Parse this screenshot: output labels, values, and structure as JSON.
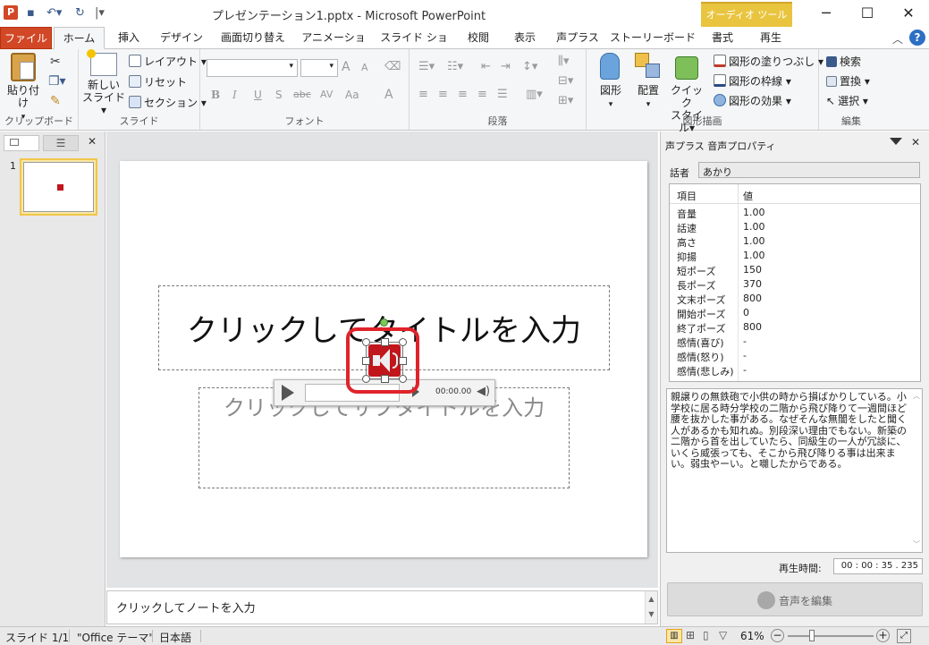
{
  "window": {
    "title": "プレゼンテーション1.pptx - Microsoft PowerPoint",
    "context_group": "オーディオ ツール",
    "minimize": "─",
    "maximize": "☐",
    "close": "✕"
  },
  "tabs": [
    "ファイル",
    "ホーム",
    "挿入",
    "デザイン",
    "画面切り替え",
    "アニメーション",
    "スライド ショー",
    "校閲",
    "表示",
    "声プラス",
    "ストーリーボード",
    "書式",
    "再生"
  ],
  "ribbon": {
    "clipboard": {
      "paste": "貼り付け",
      "label": "クリップボード"
    },
    "slides": {
      "new_slide_1": "新しい",
      "new_slide_2": "スライド",
      "layout": "レイアウト",
      "reset": "リセット",
      "section": "セクション",
      "label": "スライド"
    },
    "font": {
      "label": "フォント",
      "bold": "B",
      "italic": "I",
      "underline": "U",
      "shadow": "S",
      "strike": "abc",
      "spacing": "AV",
      "case": "Aa",
      "grow": "A",
      "shrink": "A",
      "color": "A"
    },
    "paragraph": {
      "label": "段落"
    },
    "drawing": {
      "shapes": "図形",
      "arrange": "配置",
      "quick_style_1": "クイック",
      "quick_style_2": "スタイル",
      "fill": "図形の塗りつぶし",
      "outline": "図形の枠線",
      "effects": "図形の効果",
      "label": "図形描画"
    },
    "editing": {
      "find": "検索",
      "replace": "置換",
      "select": "選択",
      "label": "編集"
    }
  },
  "thumbnails": {
    "number": "1"
  },
  "slide": {
    "title_placeholder": "クリックしてタイトルを入力",
    "subtitle_placeholder": "クリックしてサブタイトルを入力"
  },
  "audio_player": {
    "time": "00:00.00"
  },
  "notes": {
    "placeholder": "クリックしてノートを入力"
  },
  "pane": {
    "title": "声プラス 音声プロパティ",
    "speaker_label": "話者",
    "speaker_value": "あかり",
    "table_headers": [
      "項目",
      "値"
    ],
    "properties": [
      {
        "name": "音量",
        "value": "1.00"
      },
      {
        "name": "話速",
        "value": "1.00"
      },
      {
        "name": "高さ",
        "value": "1.00"
      },
      {
        "name": "抑揚",
        "value": "1.00"
      },
      {
        "name": "短ポーズ",
        "value": "150"
      },
      {
        "name": "長ポーズ",
        "value": "370"
      },
      {
        "name": "文末ポーズ",
        "value": "800"
      },
      {
        "name": "開始ポーズ",
        "value": "0"
      },
      {
        "name": "終了ポーズ",
        "value": "800"
      },
      {
        "name": "感情(喜び)",
        "value": "-"
      },
      {
        "name": "感情(怒り)",
        "value": "-"
      },
      {
        "name": "感情(悲しみ)",
        "value": "-"
      }
    ],
    "text": "親譲りの無鉄砲で小供の時から損ばかりしている。小学校に居る時分学校の二階から飛び降りて一週間ほど腰を抜かした事がある。なぜそんな無闇をしたと聞く人があるかも知れぬ。別段深い理由でもない。新築の二階から首を出していたら、同級生の一人が冗談に、いくら威張っても、そこから飛び降りる事は出来まい。弱虫やーい。と囃したからである。",
    "play_time_label": "再生時間:",
    "play_time_value": "00 : 00 : 35 . 235",
    "edit_button": "音声を編集"
  },
  "status": {
    "slide": "スライド 1/1",
    "theme": "\"Office テーマ\"",
    "language": "日本語",
    "zoom": "61%"
  }
}
